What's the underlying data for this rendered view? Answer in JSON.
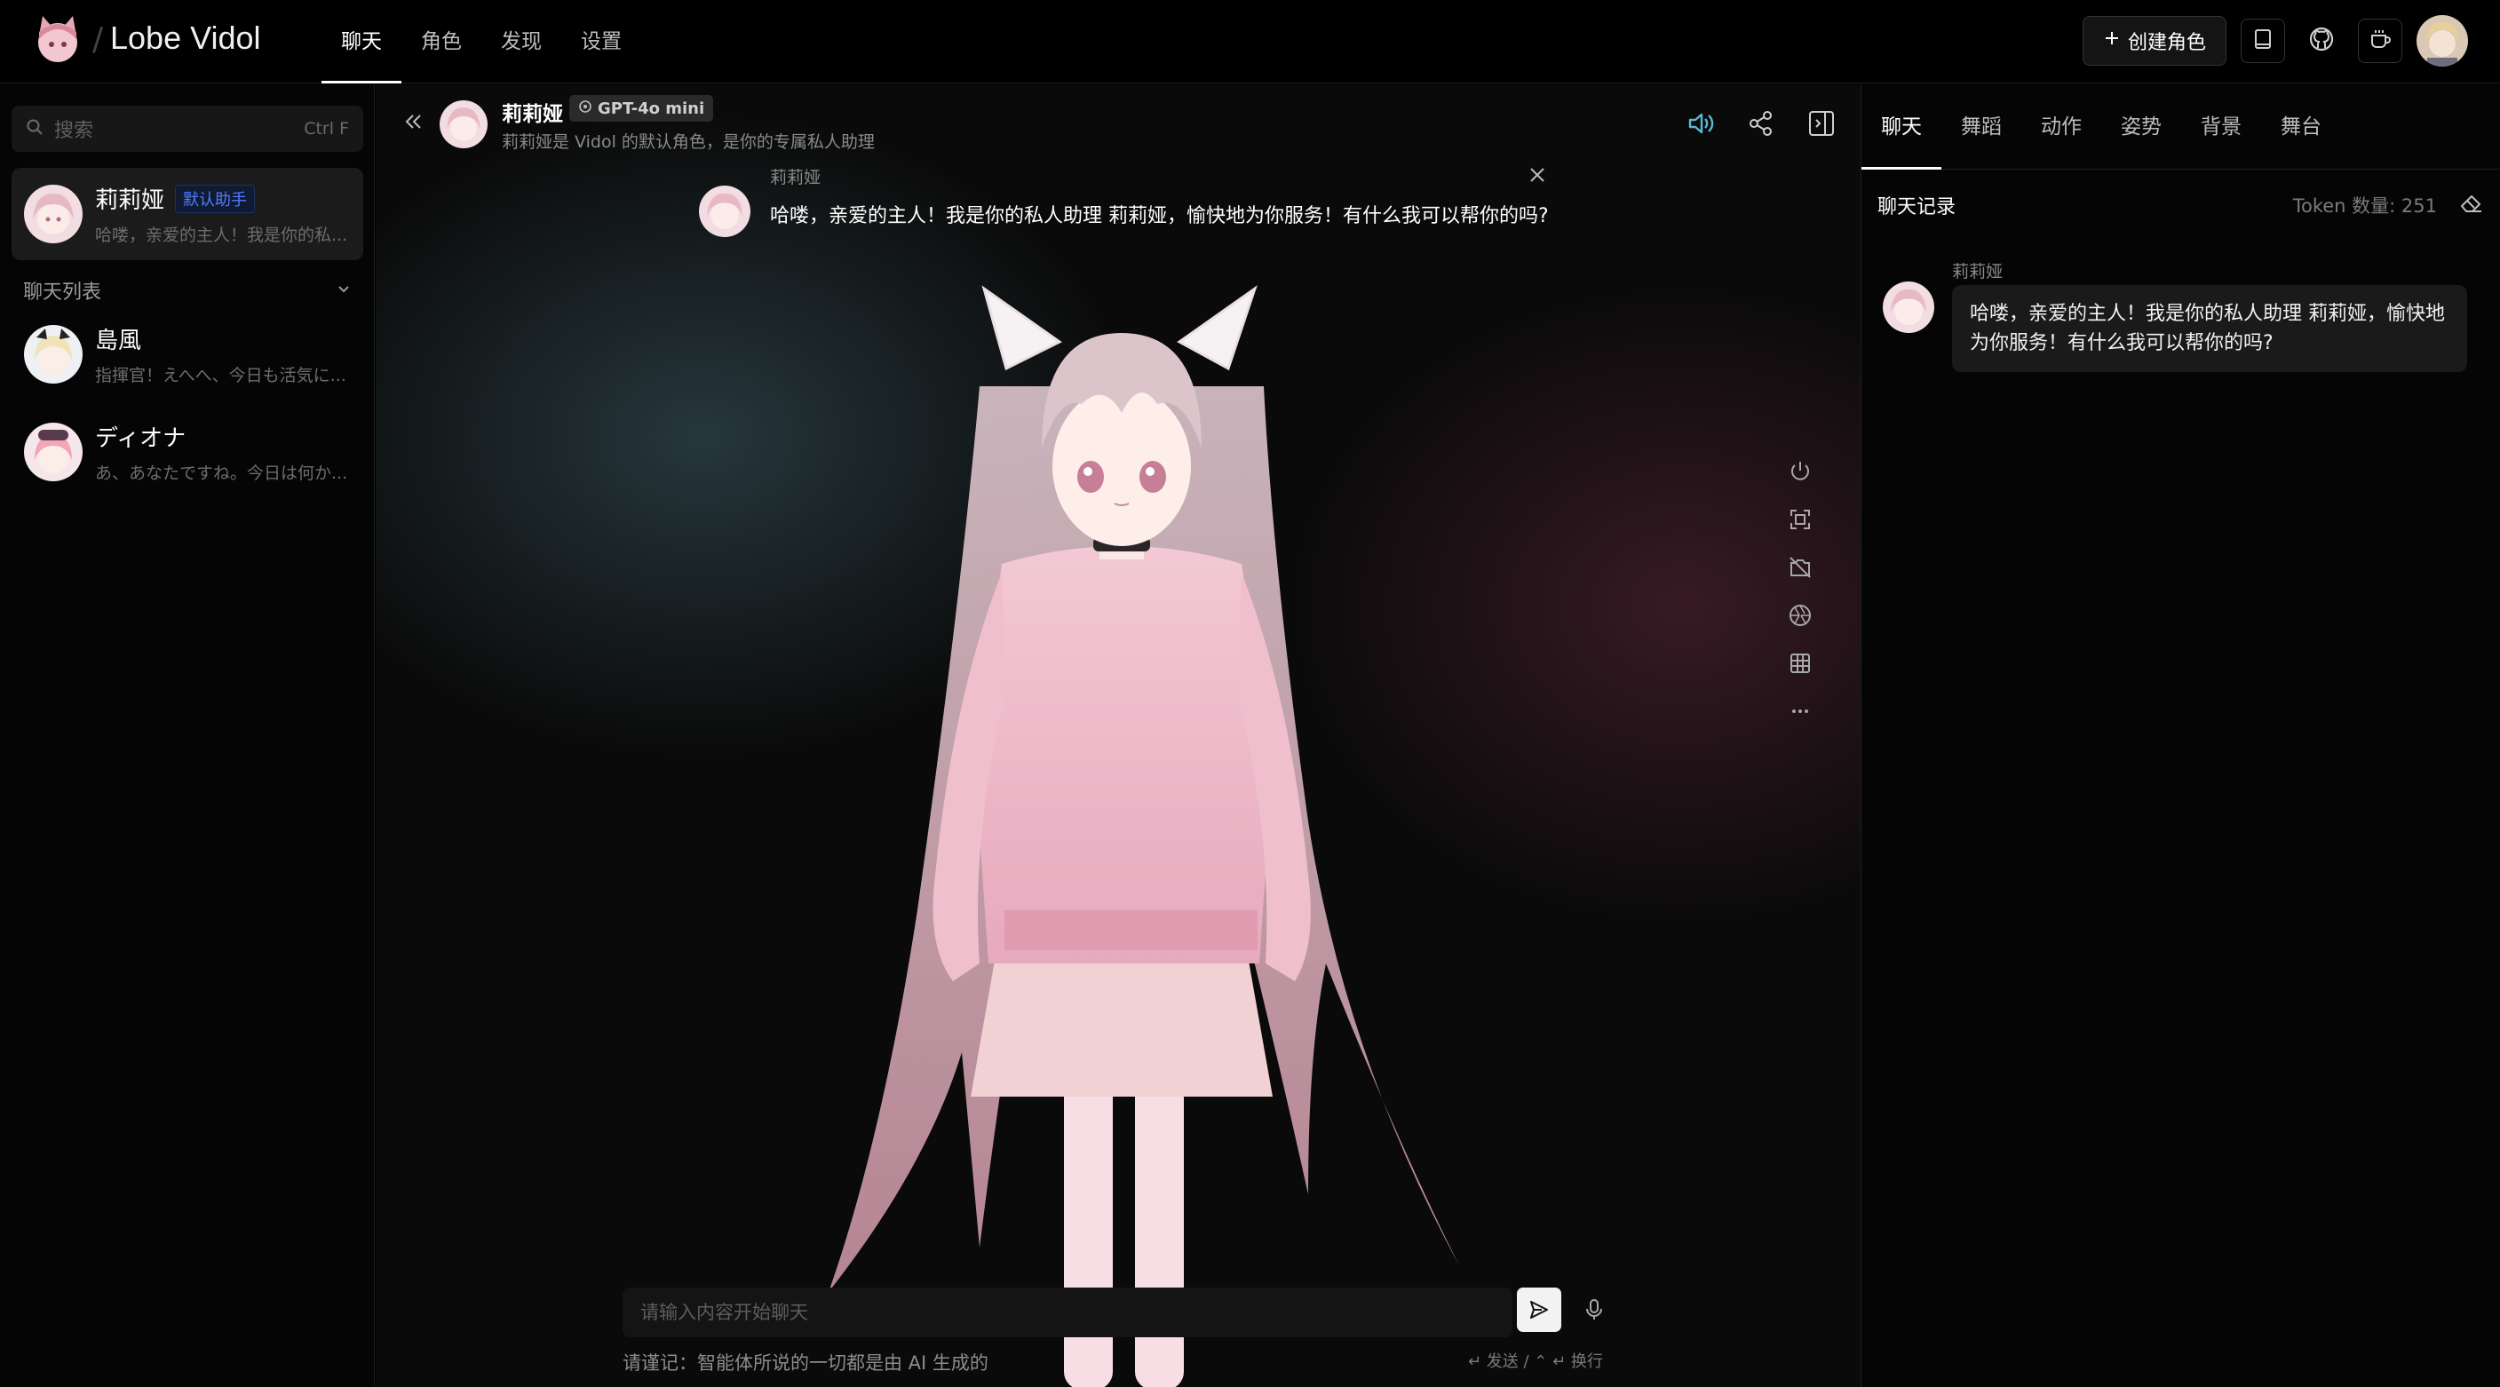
{
  "app": {
    "brand": "Lobe Vidol"
  },
  "nav": {
    "items": [
      "聊天",
      "角色",
      "发现",
      "设置"
    ],
    "active_index": 0
  },
  "header": {
    "create_label": "创建角色"
  },
  "sidebar": {
    "search_placeholder": "搜索",
    "search_shortcut": "Ctrl F",
    "default_session": {
      "title": "莉莉娅",
      "badge": "默认助手",
      "desc": "哈喽，亲爱的主人！我是你的私..."
    },
    "list_header": "聊天列表",
    "sessions": [
      {
        "title": "島風",
        "desc": "指揮官！えへへ、今日も活気に..."
      },
      {
        "title": "ディオナ",
        "desc": "あ、あなたですね。今日は何か..."
      }
    ]
  },
  "chat": {
    "agent_name": "莉莉娅",
    "model": "GPT-4o mini",
    "agent_desc": "莉莉娅是 Vidol 的默认角色，是你的专属私人助理",
    "bubble": {
      "name": "莉莉娅",
      "text": "哈喽，亲爱的主人！我是你的私人助理 莉莉娅，愉快地为你服务！有什么我可以帮你的吗?"
    },
    "input_placeholder": "请输入内容开始聊天",
    "footnote": "请谨记：智能体所说的一切都是由 AI 生成的",
    "shortcut_hint": "↵ 发送 / ⌃ ↵ 换行"
  },
  "right_panel": {
    "tabs": [
      "聊天",
      "舞蹈",
      "动作",
      "姿势",
      "背景",
      "舞台"
    ],
    "active_index": 0,
    "history_title": "聊天记录",
    "token_label": "Token 数量: 251",
    "message": {
      "name": "莉莉娅",
      "text": "哈喽，亲爱的主人！我是你的私人助理 莉莉娅，愉快地为你服务！有什么我可以帮你的吗?"
    }
  },
  "colors": {
    "accent": "#4f7cff",
    "speaker_active": "#5bb8d6",
    "background": "#000000"
  }
}
